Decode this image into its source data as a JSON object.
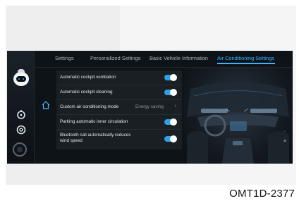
{
  "figure_caption": "OMT1D-2377",
  "tabs": [
    {
      "label": "Settings",
      "active": false
    },
    {
      "label": "Personalized Settings",
      "active": false
    },
    {
      "label": "Basic Vehicle Information",
      "active": false
    },
    {
      "label": "Air Conditioning Settings",
      "active": true
    }
  ],
  "settings": [
    {
      "label": "Automatic cockpit ventilation",
      "control": "toggle",
      "on": true
    },
    {
      "label": "Automatic cockpit cleaning",
      "control": "toggle",
      "on": true
    },
    {
      "label": "Custom air conditioning mode",
      "control": "select",
      "value": "Energy saving"
    },
    {
      "label": "Parking automatic inner circulation",
      "control": "toggle",
      "on": true
    },
    {
      "label": "Bluetooth call automatically reduces wind speed",
      "control": "toggle",
      "on": true
    }
  ],
  "colors": {
    "accent": "#3fb1ff",
    "toggle_on": "#2f9fe6",
    "screen_bg": "#0e1318"
  },
  "icons": {
    "rail": [
      "robot-assistant-icon",
      "steering-icon",
      "location-icon",
      "record-button-icon"
    ],
    "home": "home-icon",
    "chevron": "chevron-right-icon"
  }
}
